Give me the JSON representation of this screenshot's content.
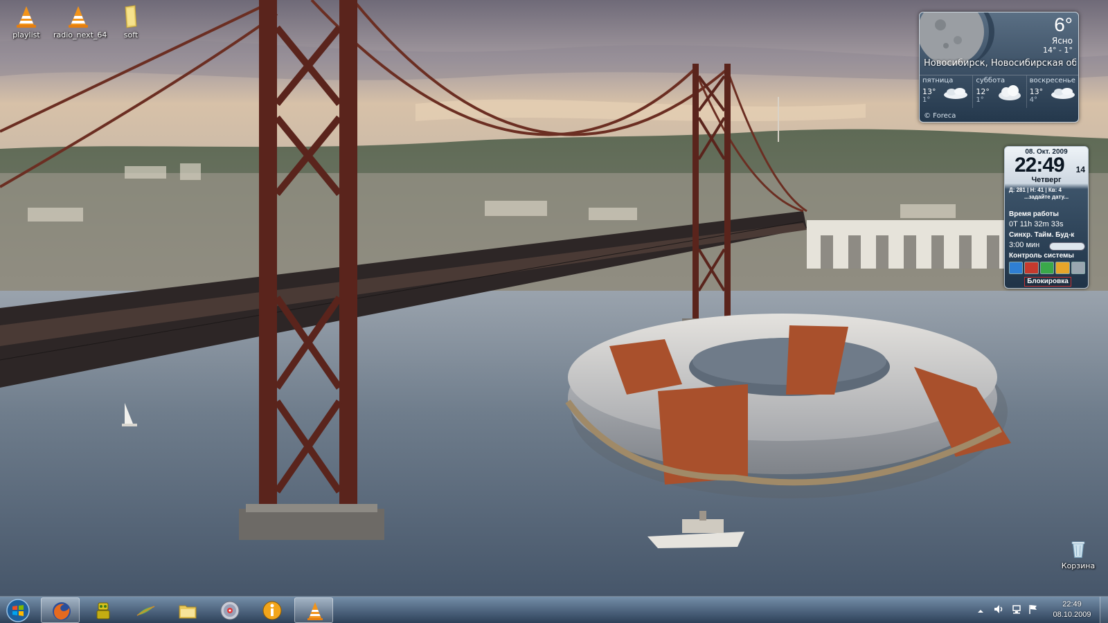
{
  "desktop": {
    "icons": [
      {
        "label": "playlist",
        "icon": "vlc-cone-icon"
      },
      {
        "label": "radio_next_64",
        "icon": "vlc-cone-icon"
      },
      {
        "label": "soft",
        "icon": "folder-icon"
      }
    ],
    "recycle_bin": {
      "label": "Корзина",
      "icon": "recycle-bin-icon"
    }
  },
  "weather": {
    "temperature": "6°",
    "condition": "Ясно",
    "range": "14° - 1°",
    "city": "Новосибирск, Новосибирская об...",
    "forecast": [
      {
        "day": "пятница",
        "high": "13°",
        "low": "1°",
        "icon": "partly-cloudy-icon"
      },
      {
        "day": "суббота",
        "high": "12°",
        "low": "1°",
        "icon": "cloud-icon"
      },
      {
        "day": "воскресенье",
        "high": "13°",
        "low": "4°",
        "icon": "partly-cloudy-icon"
      }
    ],
    "credit": "© Foreca"
  },
  "clock_gadget": {
    "date": "08. Окт. 2009",
    "time": "22:49",
    "seconds": "14",
    "weekday": "Четверг",
    "stats": "Д: 281 | Н: 41 | Кв: 4",
    "prompt": "...задайте дату...",
    "uptime_label": "Время работы",
    "uptime_value": "0T 11h 32m 33s",
    "timer_label": "Синхр. Тайм. Буд-к",
    "timer_value": "3:00 мин",
    "control_label": "Контроль системы",
    "lock_label": "Блокировка"
  },
  "taskbar": {
    "buttons": [
      {
        "name": "firefox",
        "icon": "firefox-icon",
        "active": true
      },
      {
        "name": "utility",
        "icon": "robot-icon",
        "active": false
      },
      {
        "name": "feather",
        "icon": "feather-icon",
        "active": false
      },
      {
        "name": "explorer",
        "icon": "folder-icon",
        "active": false
      },
      {
        "name": "media",
        "icon": "disc-icon",
        "active": false
      },
      {
        "name": "info",
        "icon": "info-icon",
        "active": false
      },
      {
        "name": "vlc",
        "icon": "vlc-cone-icon",
        "active": true
      }
    ],
    "clock_time": "22:49",
    "clock_date": "08.10.2009"
  }
}
